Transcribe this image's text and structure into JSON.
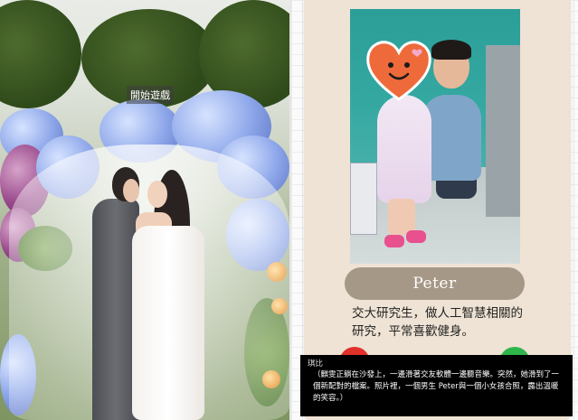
{
  "left_panel": {
    "start_button_label": "開始遊戲"
  },
  "profile_card": {
    "name": "Peter",
    "bio": "交大研究生，做人工智慧相關的研究，平常喜歡健身。",
    "reject_color": "#e0312a",
    "accept_color": "#2fb54a",
    "card_color": "#eee3d4",
    "name_pill_color": "#a69886"
  },
  "narration": {
    "speaker": "琪比",
    "text": "（麒雯正躺在沙發上，一邊滑著交友軟體一邊聽音樂。突然，她滑到了一個新配對的檔案。照片裡，一個男生 Peter與一個小女孩合照，露出溫暖的笑容。）"
  },
  "icons": {
    "face_cover": "heart-smiley-icon"
  }
}
